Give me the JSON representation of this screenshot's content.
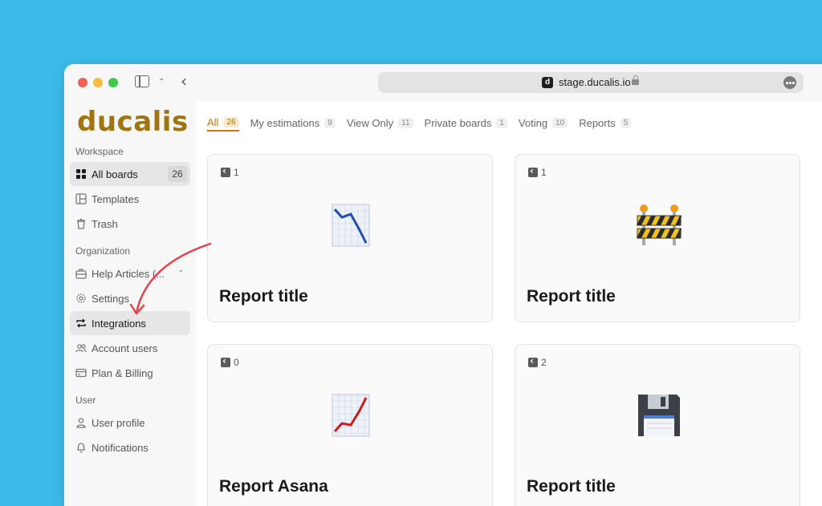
{
  "browser": {
    "url": "stage.ducalis.io",
    "favicon_letter": "d"
  },
  "sidebar": {
    "logo": "ducalis",
    "workspace_label": "Workspace",
    "organization_label": "Organization",
    "user_label": "User",
    "workspace_items": [
      {
        "label": "All boards",
        "badge": "26",
        "icon": "grid-icon",
        "active": true
      },
      {
        "label": "Templates",
        "icon": "template-icon"
      },
      {
        "label": "Trash",
        "icon": "trash-icon"
      }
    ],
    "organization_items": [
      {
        "label": "Help Articles (...",
        "icon": "briefcase-icon"
      },
      {
        "label": "Settings",
        "icon": "gear-icon"
      },
      {
        "label": "Integrations",
        "icon": "sync-icon",
        "active": true
      },
      {
        "label": "Account users",
        "icon": "users-icon"
      },
      {
        "label": "Plan & Billing",
        "icon": "card-icon"
      }
    ],
    "user_items": [
      {
        "label": "User profile",
        "icon": "user-icon"
      },
      {
        "label": "Notifications",
        "icon": "bell-icon"
      }
    ]
  },
  "tabs": [
    {
      "label": "All",
      "count": "26",
      "active": true
    },
    {
      "label": "My estimations",
      "count": "9"
    },
    {
      "label": "View Only",
      "count": "11"
    },
    {
      "label": "Private boards",
      "count": "1"
    },
    {
      "label": "Voting",
      "count": "10"
    },
    {
      "label": "Reports",
      "count": "5"
    }
  ],
  "cards": [
    {
      "title": "Report title",
      "shared_count": "1",
      "emoji": "chart-decreasing"
    },
    {
      "title": "Report title",
      "shared_count": "1",
      "emoji": "construction-barrier"
    },
    {
      "title": "Report Asana",
      "shared_count": "0",
      "emoji": "chart-increasing"
    },
    {
      "title": "Report title",
      "shared_count": "2",
      "emoji": "floppy-disk"
    }
  ],
  "colors": {
    "background": "#3bbbe8",
    "accent": "#c07a0d",
    "logo": "#a0750f",
    "annotation_arrow": "#e8434e"
  }
}
